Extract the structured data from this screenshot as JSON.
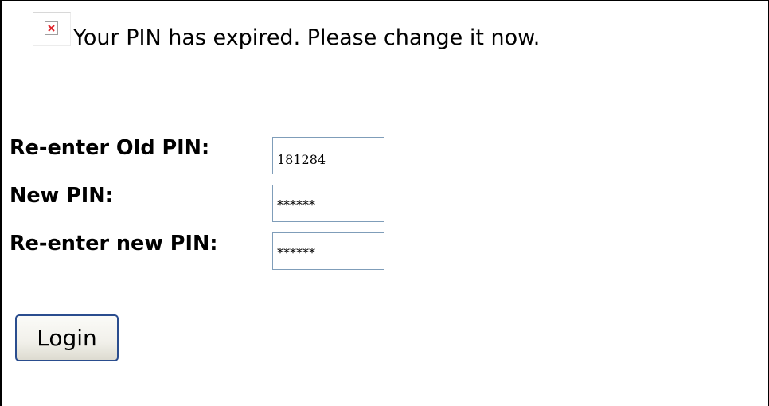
{
  "notice": {
    "icon": "broken-image-icon",
    "message": "Your PIN has expired. Please change it now."
  },
  "form": {
    "old_pin": {
      "label": "Re-enter Old PIN:",
      "value": "181284"
    },
    "new_pin": {
      "label": "New PIN:",
      "value": "******"
    },
    "confirm_pin": {
      "label": "Re-enter new PIN:",
      "value": "******"
    },
    "submit_label": "Login"
  },
  "colors": {
    "input_border": "#7f9db9",
    "button_border": "#2a4d8e",
    "broken_icon_x": "#e0262d"
  }
}
